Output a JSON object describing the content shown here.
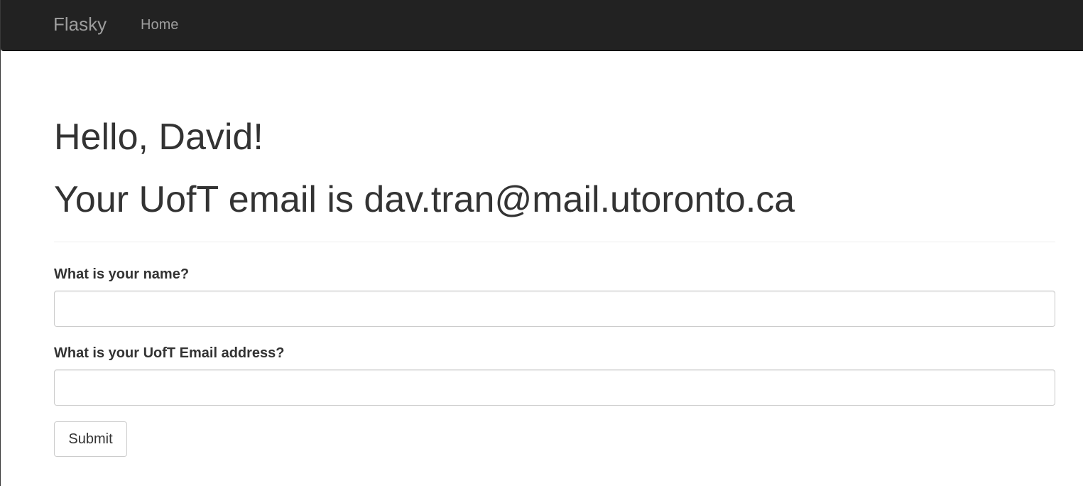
{
  "navbar": {
    "brand": "Flasky",
    "links": [
      {
        "label": "Home"
      }
    ]
  },
  "main": {
    "greeting": "Hello, David!",
    "email_message": "Your UofT email is dav.tran@mail.utoronto.ca"
  },
  "form": {
    "name_field": {
      "label": "What is your name?",
      "value": "",
      "placeholder": ""
    },
    "email_field": {
      "label": "What is your UofT Email address?",
      "value": "",
      "placeholder": ""
    },
    "submit_label": "Submit"
  },
  "colors": {
    "navbar_background": "#222222",
    "navbar_text": "#9d9d9d",
    "text": "#333333",
    "input_border": "#cccccc"
  }
}
